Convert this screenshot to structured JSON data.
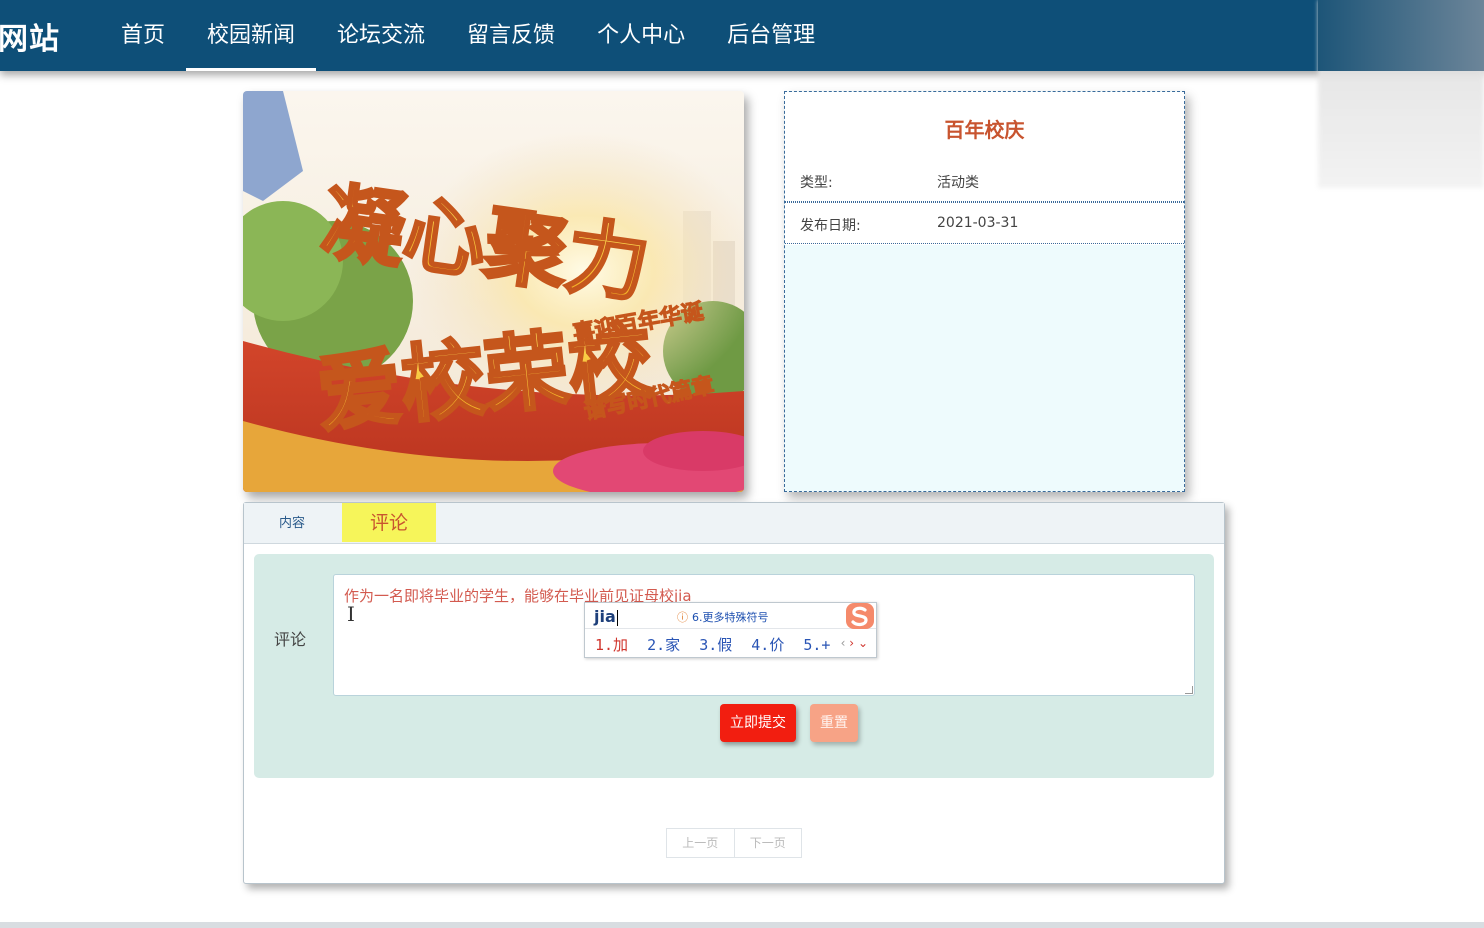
{
  "site": {
    "logo_text": "网站"
  },
  "nav": {
    "items": [
      {
        "label": "首页"
      },
      {
        "label": "校园新闻"
      },
      {
        "label": "论坛交流"
      },
      {
        "label": "留言反馈"
      },
      {
        "label": "个人中心"
      },
      {
        "label": "后台管理"
      }
    ],
    "active_index": 1
  },
  "news": {
    "image_text": {
      "line1": "凝心聚力",
      "line2": "爱校荣校",
      "side1": "喜迎百年华诞",
      "side2": "谱写时代篇章"
    },
    "title": "百年校庆",
    "rows": [
      {
        "label": "类型:",
        "value": "活动类"
      },
      {
        "label": "发布日期:",
        "value": "2021-03-31"
      }
    ]
  },
  "tabs": [
    {
      "label": "内容"
    },
    {
      "label": "评论"
    }
  ],
  "comment_form": {
    "label": "评论",
    "text": "作为一名即将毕业的学生，能够在毕业前见证母校jia",
    "submit_label": "立即提交",
    "reset_label": "重置"
  },
  "ime": {
    "input": "jia",
    "hint": "6.更多特殊符号",
    "candidates": [
      "1.加",
      "2.家",
      "3.假",
      "4.价",
      "5.+"
    ]
  },
  "pager": {
    "prev": "上一页",
    "next": "下一页"
  },
  "colors": {
    "nav_bg": "#0e4f78",
    "title": "#c8542f",
    "submit": "#f21e10",
    "reset": "#f7a386",
    "active_tab": "#f6f55a"
  }
}
